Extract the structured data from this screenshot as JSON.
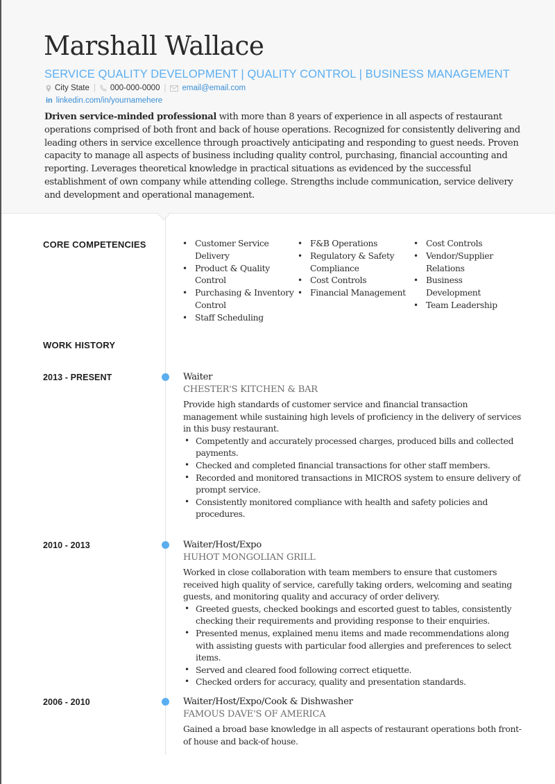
{
  "header": {
    "name": "Marshall Wallace",
    "headline": "SERVICE QUALITY DEVELOPMENT | QUALITY CONTROL | BUSINESS MANAGEMENT",
    "contact": {
      "location_icon": "map-pin-icon",
      "location": "City State",
      "phone_icon": "phone-icon",
      "phone": "000-000-0000",
      "email_icon": "envelope-icon",
      "email": "email@email.com",
      "separator": "|",
      "linkedin_icon": "linkedin-icon",
      "linkedin_glyph": "in",
      "linkedin": "linkedin.com/in/yournamehere"
    },
    "summary_bold": "Driven service-minded professional",
    "summary_rest": " with more than 8 years of experience in all aspects of restaurant operations comprised of both front and back of house operations. Recognized for consistently delivering and leading others in service excellence through proactively anticipating and responding to guest needs. Proven capacity to manage all aspects of business including quality control, purchasing, financial accounting and reporting. Leverages theoretical knowledge in practical situations as evidenced by the successful establishment of own company while attending college. Strengths include communication, service delivery and development and operational management."
  },
  "colors": {
    "accent": "#5aaef0",
    "link": "#3a8fd6",
    "header_bg": "#f7f7f7",
    "timeline": "#e4e4e4"
  },
  "competencies": {
    "title": "CORE COMPETENCIES",
    "columns": [
      [
        "Customer Service Delivery",
        "Product & Quality Control",
        "Purchasing & Inventory Control",
        "Staff Scheduling"
      ],
      [
        "F&B Operations",
        "Regulatory & Safety Compliance",
        "Cost Controls",
        "Financial Management"
      ],
      [
        "Cost Controls",
        "Vendor/Supplier Relations",
        "Business Development",
        "Team Leadership"
      ]
    ]
  },
  "work_history": {
    "title": "WORK HISTORY",
    "jobs": [
      {
        "dates": "2013 - PRESENT",
        "title": "Waiter",
        "company": "CHESTER'S KITCHEN & BAR",
        "description": "Provide high standards of customer service and financial transaction management while sustaining high levels of proficiency in the delivery of services in this busy restaurant.",
        "bullets": [
          "Competently and accurately processed charges, produced bills and collected payments.",
          "Checked and completed financial transactions for other staff members.",
          "Recorded and monitored transactions in MICROS system to ensure delivery of prompt service.",
          "Consistently monitored compliance with health and safety policies and procedures."
        ]
      },
      {
        "dates": "2010 - 2013",
        "title": "Waiter/Host/Expo",
        "company": "HUHOT MONGOLIAN GRILL",
        "description": "Worked in close collaboration with team members to ensure that customers received high quality of service, carefully taking orders, welcoming and seating guests, and monitoring quality and accuracy of order delivery.",
        "bullets": [
          "Greeted guests, checked bookings and escorted guest to tables, consistently checking their requirements and providing response to their enquiries.",
          "Presented menus, explained menu items and made recommendations along with assisting guests with particular food allergies and preferences to select items.",
          "Served and cleared food following correct etiquette.",
          "Checked orders for accuracy, quality and presentation standards."
        ]
      },
      {
        "dates": "2006 - 2010",
        "title": "Waiter/Host/Expo/Cook & Dishwasher",
        "company": "FAMOUS DAVE'S OF AMERICA",
        "description": "Gained a broad base knowledge in all aspects of restaurant operations both front-of house and back-of house.",
        "bullets": []
      }
    ]
  }
}
